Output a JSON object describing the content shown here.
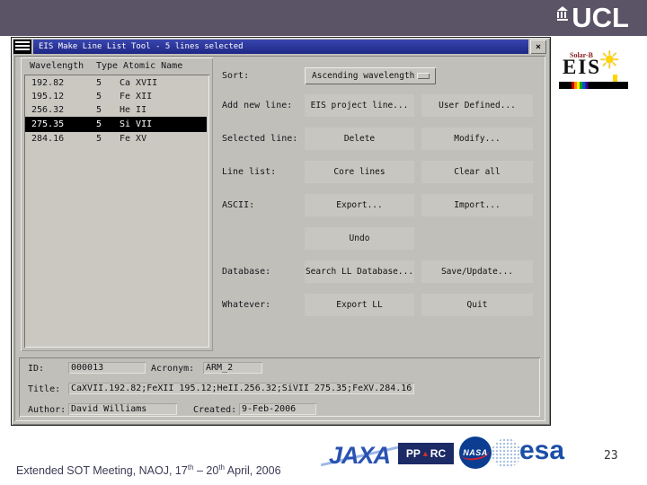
{
  "colors": {
    "top_bar": "#5b5366",
    "title_bar": "#262f9a",
    "dialog_bg": "#c0bfba",
    "selection": "#000000",
    "jaxa_blue": "#2a52b2",
    "pparc_navy": "#1c2a66",
    "nasa_blue": "#0b3d91",
    "esa_blue": "#1b4fa8"
  },
  "header": {
    "ucl_logo_text": "UCL"
  },
  "eis_logo": {
    "solar_b": "Solar-B",
    "name": "EIS",
    "sun_icon": "☀"
  },
  "window": {
    "title": "EIS Make Line List Tool - 5 lines selected",
    "close_glyph": "×",
    "table": {
      "headers": [
        "Wavelength",
        "Type",
        "Atomic Name"
      ],
      "rows": [
        {
          "wavelength": "192.82",
          "type": "5",
          "name": "Ca XVII"
        },
        {
          "wavelength": "195.12",
          "type": "5",
          "name": "Fe XII"
        },
        {
          "wavelength": "256.32",
          "type": "5",
          "name": "He II"
        },
        {
          "wavelength": "275.35",
          "type": "5",
          "name": "Si VII"
        },
        {
          "wavelength": "284.16",
          "type": "5",
          "name": "Fe XV"
        }
      ]
    },
    "rows": [
      {
        "label": "Sort:",
        "dropdown_value": "Ascending wavelength"
      },
      {
        "label": "Add new line:",
        "buttons": [
          "EIS project line...",
          "User Defined..."
        ]
      },
      {
        "label": "Selected line:",
        "buttons": [
          "Delete",
          "Modify..."
        ]
      },
      {
        "label": "Line list:",
        "buttons": [
          "Core lines",
          "Clear all"
        ]
      },
      {
        "label": "ASCII:",
        "buttons": [
          "Export...",
          "Import..."
        ]
      },
      {
        "label": "",
        "buttons": [
          "Undo"
        ]
      },
      {
        "label": "Database:",
        "buttons": [
          "Search LL Database...",
          "Save/Update..."
        ]
      },
      {
        "label": "Whatever:",
        "buttons": [
          "Export LL",
          "Quit"
        ]
      }
    ],
    "details": {
      "id_label": "ID:",
      "id_value": "000013",
      "acronym_label": "Acronym:",
      "acronym_value": "ARM_2",
      "title_label": "Title:",
      "title_value": "CaXVII.192.82;FeXII 195.12;HeII.256.32;SiVII 275.35;FeXV.284.16",
      "author_label": "Author:",
      "author_value": "David Williams",
      "created_label": "Created:",
      "created_value": "9-Feb-2006"
    }
  },
  "footer_logos": {
    "jaxa": "JAXA",
    "pparc_pp": "PP",
    "pparc_triangle": "▲",
    "pparc_rc": "RC",
    "nasa": "NASA",
    "esa": "esa"
  },
  "slide": {
    "page_number": "23",
    "footer_text_1": "Extended SOT Meeting, NAOJ, 17",
    "footer_sup_1": "th",
    "footer_text_2": " – 20",
    "footer_sup_2": "th",
    "footer_text_3": " April, 2006"
  }
}
